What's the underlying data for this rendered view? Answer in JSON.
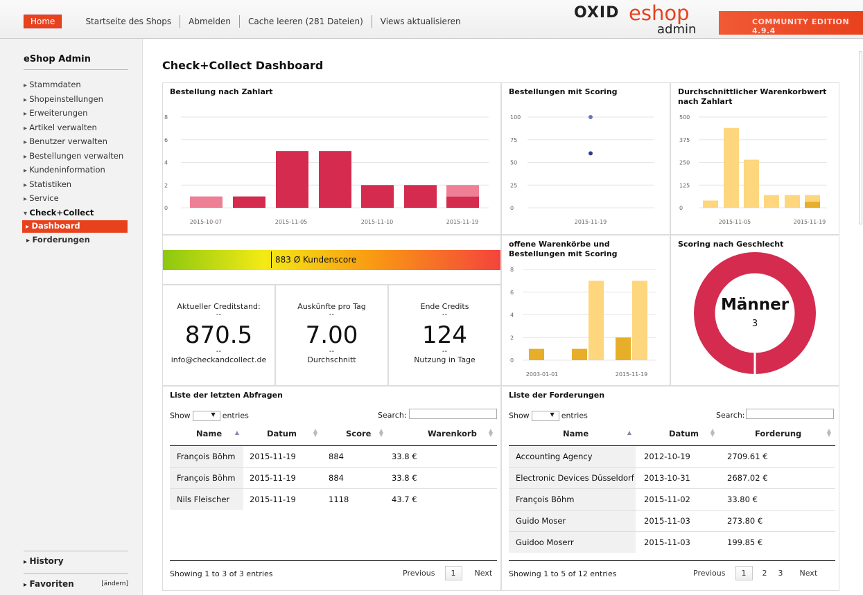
{
  "topnav": {
    "home": "Home",
    "shop_start": "Startseite des Shops",
    "logout": "Abmelden",
    "cache": "Cache leeren (281 Dateien)",
    "views": "Views aktualisieren"
  },
  "logo": {
    "oxid": "OXID",
    "eshop": "eshop",
    "admin": "admin"
  },
  "edition": "COMMUNITY EDITION 4.9.4",
  "sidebar": {
    "title": "eShop Admin",
    "items": [
      "Stammdaten",
      "Shopeinstellungen",
      "Erweiterungen",
      "Artikel verwalten",
      "Benutzer verwalten",
      "Bestellungen verwalten",
      "Kundeninformation",
      "Statistiken",
      "Service"
    ],
    "open_section": "Check+Collect",
    "sub_active": "Dashboard",
    "sub_other": "Forderungen",
    "history": "History",
    "favorites": "Favoriten",
    "change": "[ändern]"
  },
  "page_title": "Check+Collect Dashboard",
  "score_bar": {
    "label": "883 Ø Kundenscore",
    "value": 883
  },
  "kpis": [
    {
      "title": "Aktueller Creditstand:",
      "dash1": "--",
      "value": "870.5",
      "dash2": "--",
      "sub": "info@checkandcollect.de"
    },
    {
      "title": "Auskünfte pro Tag",
      "dash1": "--",
      "value": "7.00",
      "dash2": "--",
      "sub": "Durchschnitt"
    },
    {
      "title": "Ende Credits",
      "dash1": "--",
      "value": "124",
      "dash2": "--",
      "sub": "Nutzung in Tage"
    }
  ],
  "chart_data": [
    {
      "type": "bar",
      "title": "Bestellung nach Zahlart",
      "xticks": [
        "2015-10-07",
        "2015-11-05",
        "2015-11-10",
        "2015-11-19"
      ],
      "yticks": [
        "0",
        "2",
        "4",
        "6",
        "8"
      ],
      "ylim": [
        0,
        8
      ],
      "bars": [
        {
          "series": "light",
          "value": 1
        },
        {
          "series": "dark",
          "value": 1
        },
        {
          "series": "dark",
          "value": 5
        },
        {
          "series": "dark",
          "value": 5
        },
        {
          "series": "dark",
          "value": 2
        },
        {
          "series": "dark",
          "value": 2
        },
        {
          "series": "dark",
          "value": 1,
          "stack_light": 1
        }
      ],
      "colors": {
        "dark": "#d42b4f",
        "light": "#ee7f94"
      }
    },
    {
      "type": "scatter",
      "title": "Bestellungen mit Scoring",
      "xticks": [
        "2015-11-19"
      ],
      "yticks": [
        "0",
        "25",
        "50",
        "75",
        "100"
      ],
      "ylim": [
        0,
        100
      ],
      "points": [
        {
          "x": "2015-11-19",
          "y": 100,
          "color": "#6677bb"
        },
        {
          "x": "2015-11-19",
          "y": 60,
          "color": "#2a3b8f"
        }
      ]
    },
    {
      "type": "bar",
      "title": "Durchschnittlicher Warenkorbwert nach Zahlart",
      "xticks": [
        "2015-11-05",
        "2015-11-19"
      ],
      "yticks": [
        "0",
        "125",
        "250",
        "375",
        "500"
      ],
      "ylim": [
        0,
        500
      ],
      "bars": [
        {
          "series": "light",
          "value": 40
        },
        {
          "series": "light",
          "value": 440
        },
        {
          "series": "light",
          "value": 265
        },
        {
          "series": "light",
          "value": 70
        },
        {
          "series": "light",
          "value": 70
        },
        {
          "series": "light",
          "value": 70,
          "stack_dark": 33
        }
      ],
      "colors": {
        "light": "#fdd67e",
        "dark": "#e7ae2a"
      }
    },
    {
      "type": "bar",
      "title": "offene Warenkörbe und Bestellungen mit Scoring",
      "xticks": [
        "2003-01-01",
        "2015-11-19"
      ],
      "yticks": [
        "0",
        "2",
        "4",
        "6",
        "8"
      ],
      "ylim": [
        0,
        8
      ],
      "bars": [
        {
          "series": "dark",
          "value": 1
        },
        {
          "series": "dark",
          "value": 1
        },
        {
          "series": "light",
          "value": 7
        },
        {
          "series": "dark",
          "value": 2
        },
        {
          "series": "light",
          "value": 7
        }
      ],
      "colors": {
        "light": "#fdd67e",
        "dark": "#e7ae2a"
      }
    },
    {
      "type": "pie",
      "title": "Scoring nach Geschlecht",
      "label": "Männer",
      "value": "3",
      "color": "#d42b4f"
    }
  ],
  "table_left": {
    "title": "Liste der letzten Abfragen",
    "show": "Show",
    "entries": "entries",
    "search": "Search:",
    "headers": [
      "Name",
      "Datum",
      "Score",
      "Warenkorb"
    ],
    "rows": [
      [
        "François Böhm",
        "2015-11-19",
        "884",
        "33.8 €"
      ],
      [
        "François Böhm",
        "2015-11-19",
        "884",
        "33.8 €"
      ],
      [
        "Nils Fleischer",
        "2015-11-19",
        "1118",
        "43.7 €"
      ]
    ],
    "info": "Showing 1 to 3 of 3 entries",
    "prev": "Previous",
    "page": "1",
    "next": "Next"
  },
  "table_right": {
    "title": "Liste der Forderungen",
    "show": "Show",
    "entries": "entries",
    "search": "Search:",
    "headers": [
      "Name",
      "Datum",
      "Forderung"
    ],
    "rows": [
      [
        "Accounting Agency",
        "2012-10-19",
        "2709.61 €"
      ],
      [
        "Electronic Devices Düsseldorf",
        "2013-10-31",
        "2687.02 €"
      ],
      [
        "François Böhm",
        "2015-11-02",
        "33.80 €"
      ],
      [
        "Guido Moser",
        "2015-11-03",
        "273.80 €"
      ],
      [
        "Guidoo Moserr",
        "2015-11-03",
        "199.85 €"
      ]
    ],
    "info": "Showing 1 to 5 of 12 entries",
    "prev": "Previous",
    "pages": [
      "1",
      "2",
      "3"
    ],
    "next": "Next"
  }
}
